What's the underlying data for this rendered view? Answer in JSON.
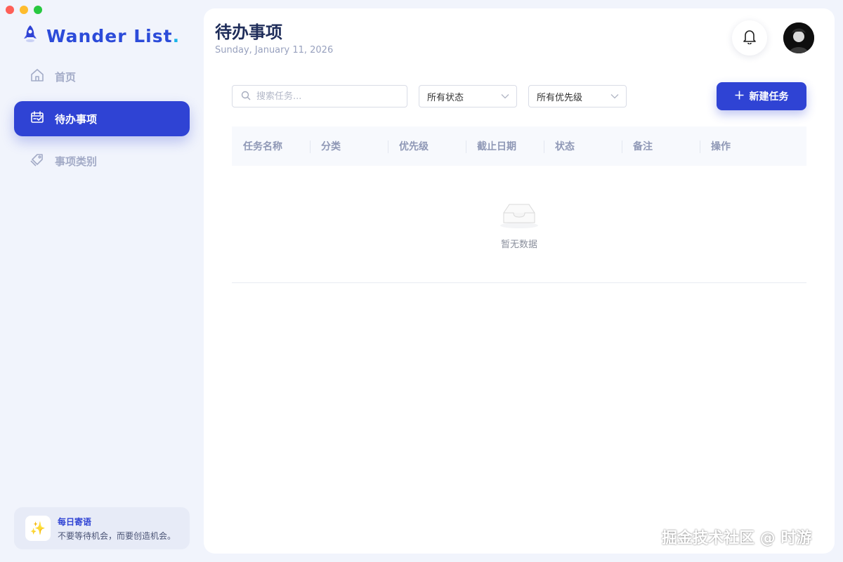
{
  "app": {
    "brand_name": "Wander List",
    "brand_dot": "."
  },
  "sidebar": {
    "items": [
      {
        "label": "首页",
        "icon": "home-icon"
      },
      {
        "label": "待办事项",
        "icon": "calendar-check-icon",
        "active": true
      },
      {
        "label": "事项类别",
        "icon": "tag-icon"
      }
    ],
    "quote": {
      "title": "每日寄语",
      "text": "不要等待机会，而要创造机会。",
      "icon": "sparkles-icon"
    }
  },
  "header": {
    "title": "待办事项",
    "date": "Sunday, January 11, 2026"
  },
  "filters": {
    "search_placeholder": "搜索任务...",
    "status_value": "所有状态",
    "priority_value": "所有优先级"
  },
  "toolbar": {
    "new_task_label": "新建任务"
  },
  "table": {
    "columns": [
      "任务名称",
      "分类",
      "优先级",
      "截止日期",
      "状态",
      "备注",
      "操作"
    ],
    "empty_text": "暂无数据"
  },
  "watermark": "掘金技术社区 @ 时游",
  "colors": {
    "accent": "#2f43d4",
    "brand_dot": "#19b4e8",
    "background": "#f1f4fc"
  }
}
